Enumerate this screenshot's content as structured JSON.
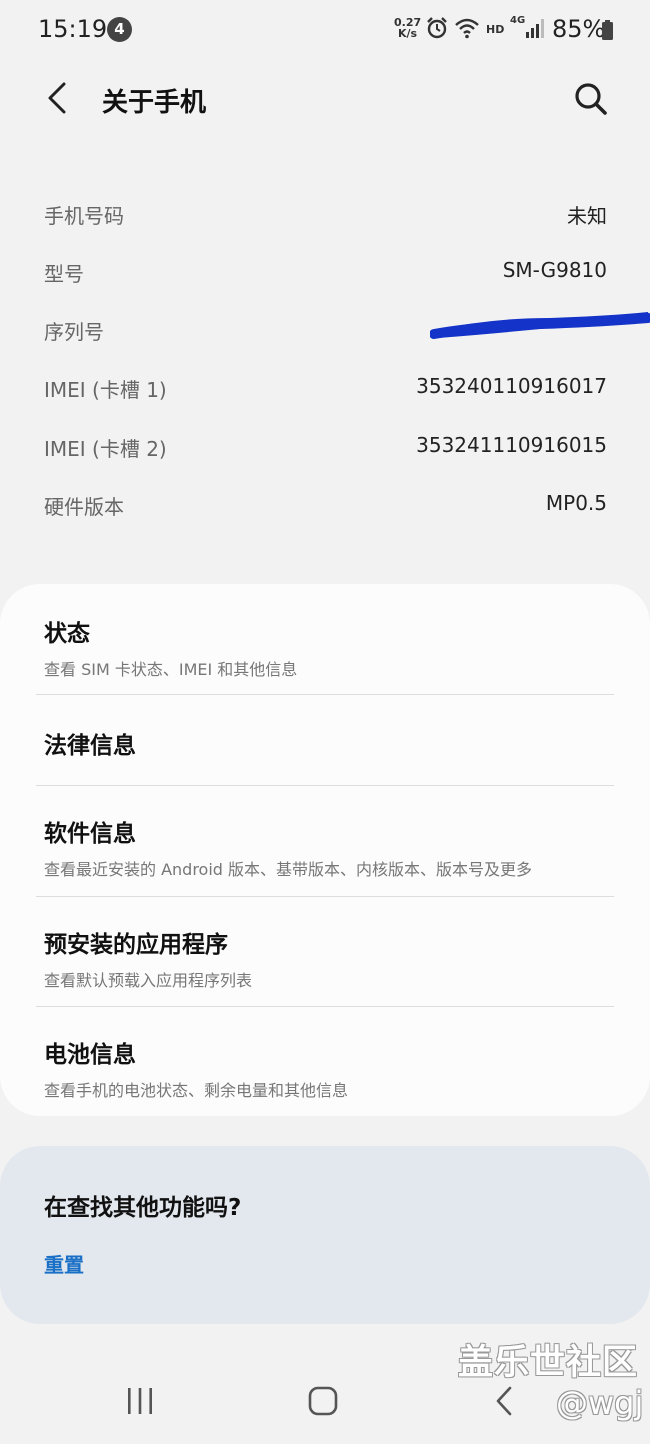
{
  "status_bar": {
    "time": "15:19",
    "notification_count": "4",
    "net_speed_value": "0.27",
    "net_speed_unit": "K/s",
    "hd": "HD",
    "network": "4G",
    "battery": "85%"
  },
  "header": {
    "title": "关于手机",
    "back_icon": "back-arrow-icon",
    "search_icon": "search-icon"
  },
  "info": [
    {
      "label": "手机号码",
      "value": "未知"
    },
    {
      "label": "型号",
      "value": "SM-G9810"
    },
    {
      "label": "序列号",
      "value": ""
    },
    {
      "label": "IMEI (卡槽 1)",
      "value": "353240110916017"
    },
    {
      "label": "IMEI (卡槽 2)",
      "value": "353241110916015"
    },
    {
      "label": "硬件版本",
      "value": "MP0.5"
    }
  ],
  "menu": [
    {
      "title": "状态",
      "subtitle": "查看 SIM 卡状态、IMEI 和其他信息"
    },
    {
      "title": "法律信息",
      "subtitle": ""
    },
    {
      "title": "软件信息",
      "subtitle": "查看最近安装的 Android 版本、基带版本、内核版本、版本号及更多"
    },
    {
      "title": "预安装的应用程序",
      "subtitle": "查看默认预载入应用程序列表"
    },
    {
      "title": "电池信息",
      "subtitle": "查看手机的电池状态、剩余电量和其他信息"
    }
  ],
  "find_more": {
    "title": "在查找其他功能吗?",
    "reset": "重置"
  },
  "watermark": {
    "site": "盖乐世社区",
    "user": "@wgj"
  },
  "colors": {
    "background": "#f2f2f2",
    "card": "#fcfcfc",
    "find_card": "#e3e8ee",
    "link": "#1a6fc6",
    "redaction": "#1433c8"
  }
}
